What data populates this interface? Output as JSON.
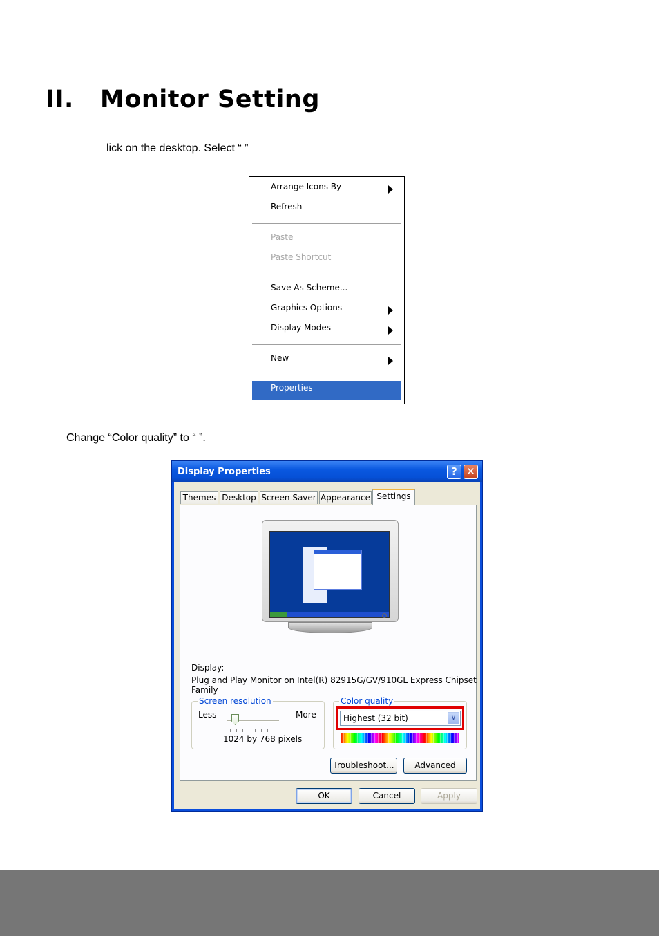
{
  "heading": {
    "number": "II.",
    "title": "Monitor Setting"
  },
  "steps": {
    "step1": "lick on the desktop. Select “                   ”",
    "step2": "Change “Color quality” to “                          ”."
  },
  "context_menu": {
    "items": [
      {
        "label": "Arrange Icons By"
      },
      {
        "label": "Refresh"
      },
      {
        "label": "Paste"
      },
      {
        "label": "Paste Shortcut"
      },
      {
        "label": "Save As Scheme..."
      },
      {
        "label": "Graphics Options"
      },
      {
        "label": "Display Modes"
      },
      {
        "label": "New"
      },
      {
        "label": "Properties"
      }
    ]
  },
  "dialog": {
    "title": "Display Properties",
    "help_glyph": "?",
    "close_glyph": "✕",
    "tabs": [
      "Themes",
      "Desktop",
      "Screen Saver",
      "Appearance",
      "Settings"
    ],
    "display_label": "Display:",
    "display_value_line1": "Plug and Play Monitor on Intel(R) 82915G/GV/910GL Express Chipset",
    "display_value_line2": "Family",
    "screen_resolution": {
      "legend": "Screen resolution",
      "less": "Less",
      "more": "More",
      "value": "1024 by 768 pixels"
    },
    "color_quality": {
      "legend": "Color quality",
      "selected": "Highest (32 bit)"
    },
    "buttons": {
      "troubleshoot": "Troubleshoot...",
      "advanced": "Advanced",
      "ok": "OK",
      "cancel": "Cancel",
      "apply": "Apply"
    }
  },
  "colors": {
    "menu_highlight": "#316ac5",
    "title_bar": "#0a58e0",
    "callout_box": "#e00000",
    "footer_bar": "#767676"
  }
}
